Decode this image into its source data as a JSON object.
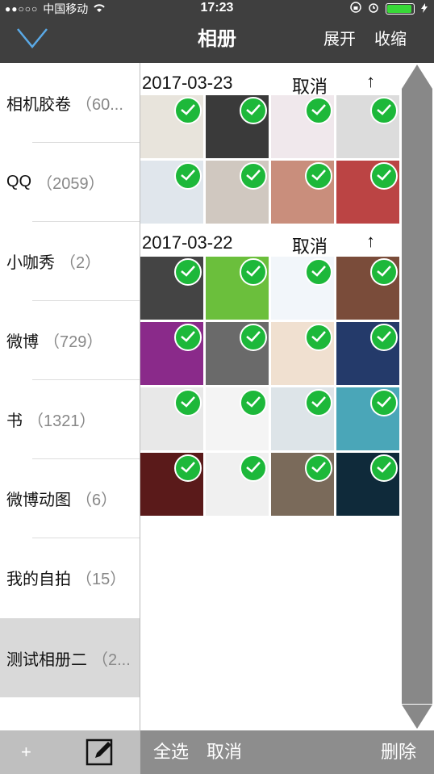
{
  "status_bar": {
    "carrier": "中国移动",
    "time": "17:23",
    "wifi_icon": "wifi-icon",
    "lock_icon": "rotation-lock-icon",
    "alarm_icon": "alarm-icon",
    "charging_icon": "charging-icon"
  },
  "nav": {
    "title": "相册",
    "expand": "展开",
    "collapse": "收缩"
  },
  "sidebar": {
    "albums": [
      {
        "name": "相机胶卷",
        "count": "（60..."
      },
      {
        "name": "QQ",
        "count": "（2059）"
      },
      {
        "name": "小咖秀",
        "count": "（2）"
      },
      {
        "name": "微博",
        "count": "（729）"
      },
      {
        "name": "书",
        "count": "（1321）"
      },
      {
        "name": "微博动图",
        "count": "（6）"
      },
      {
        "name": "我的自拍",
        "count": "（15）"
      },
      {
        "name": "测试相册二",
        "count": "（2..."
      }
    ]
  },
  "sections": [
    {
      "date": "2017-03-23",
      "cancel": "取消",
      "up": "↑"
    },
    {
      "date": "2017-03-22",
      "cancel": "取消",
      "up": "↑"
    }
  ],
  "thumb_colors": {
    "s1": [
      "#e8e4dc",
      "#3a3a3a",
      "#f0e8ec",
      "#dcdcdc",
      "#e0e6ec",
      "#d0c8c0",
      "#c98e7c",
      "#b44"
    ],
    "s2": [
      "#444",
      "#6bbf3c",
      "#f2f6fa",
      "#7a4c3a",
      "#8a2a8a",
      "#6a6a6a",
      "#f0e0d0",
      "#243a6a",
      "#e8e8e8",
      "#f4f4f4",
      "#dde4e8",
      "#4aa6b8",
      "#5a1a1a",
      "#f0f0f0",
      "#7a6a5a",
      "#0f2a3a"
    ]
  },
  "bottom": {
    "add": "+",
    "select_all": "全选",
    "cancel": "取消",
    "delete": "删除"
  }
}
